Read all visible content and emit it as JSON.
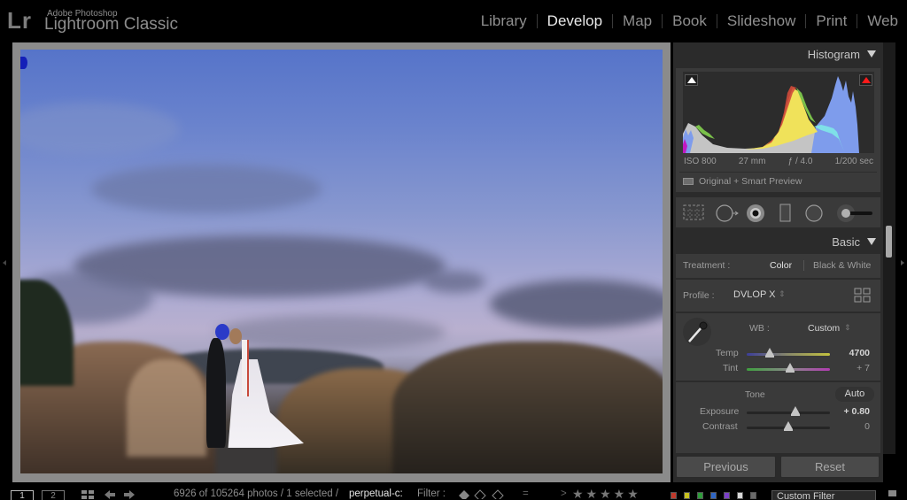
{
  "app": {
    "logo": "Lr",
    "brand_small": "Adobe Photoshop",
    "brand_big": "Lightroom Classic"
  },
  "modules": [
    {
      "label": "Library",
      "active": false
    },
    {
      "label": "Develop",
      "active": true
    },
    {
      "label": "Map",
      "active": false
    },
    {
      "label": "Book",
      "active": false
    },
    {
      "label": "Slideshow",
      "active": false
    },
    {
      "label": "Print",
      "active": false
    },
    {
      "label": "Web",
      "active": false
    }
  ],
  "histogram": {
    "title": "Histogram",
    "iso": "ISO 800",
    "focal_length": "27 mm",
    "aperture": "ƒ / 4.0",
    "shutter": "1/200 sec",
    "preview_status": "Original + Smart Preview",
    "clipping": {
      "shadow_color": "#ffffff",
      "highlight_color": "#ff1a1a"
    }
  },
  "tools": [
    {
      "icon": "crop-overlay-icon"
    },
    {
      "icon": "spot-removal-icon"
    },
    {
      "icon": "red-eye-icon"
    },
    {
      "icon": "graduated-filter-icon"
    },
    {
      "icon": "radial-filter-icon"
    },
    {
      "icon": "adjustment-brush-icon"
    }
  ],
  "basic": {
    "title": "Basic",
    "treatment_label": "Treatment :",
    "treatment_color": "Color",
    "treatment_bw": "Black & White",
    "profile_label": "Profile :",
    "profile_value": "DVLOP X",
    "wb_label": "WB :",
    "wb_value": "Custom",
    "temp_label": "Temp",
    "temp_value": "4700",
    "temp_position": 0.28,
    "tint_label": "Tint",
    "tint_value": "+ 7",
    "tint_position": 0.52,
    "tone_label": "Tone",
    "auto_label": "Auto",
    "exposure_label": "Exposure",
    "exposure_value": "+ 0.80",
    "exposure_position": 0.58,
    "contrast_label": "Contrast",
    "contrast_value": "0",
    "contrast_position": 0.5
  },
  "buttons": {
    "previous": "Previous",
    "reset": "Reset"
  },
  "filmstrip": {
    "screen1": "1",
    "screen2": "2",
    "status_text": "6926 of 105264 photos / 1 selected /",
    "source_name": "perpetual-c:",
    "filter_label": "Filter :",
    "filter_preset": "Custom Filter",
    "color_labels": [
      "#c0392b",
      "#c9c21f",
      "#2e9c3a",
      "#2f66c6",
      "#7b3fc8",
      "#d8d8d8",
      "#6a6a6a"
    ]
  }
}
